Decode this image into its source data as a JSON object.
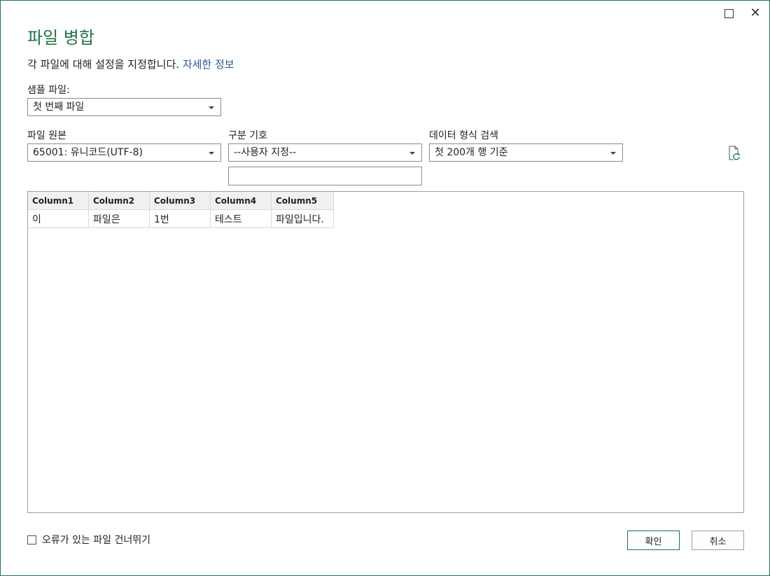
{
  "dialog": {
    "title": "파일 병합",
    "subtitle": "각 파일에 대해 설정을 지정합니다.",
    "learn_more": "자세한 정보"
  },
  "sample_file": {
    "label": "샘플 파일:",
    "value": "첫 번째 파일"
  },
  "file_origin": {
    "label": "파일 원본",
    "value": "65001: 유니코드(UTF-8)"
  },
  "delimiter": {
    "label": "구분 기호",
    "value": "--사용자 지정--",
    "custom_value": ""
  },
  "data_type_detection": {
    "label": "데이터 형식 검색",
    "value": "첫 200개 행 기준"
  },
  "preview": {
    "columns": [
      "Column1",
      "Column2",
      "Column3",
      "Column4",
      "Column5"
    ],
    "rows": [
      [
        "이",
        "파일은",
        "1번",
        "테스트",
        "파일입니다."
      ]
    ]
  },
  "skip_errors": {
    "label": "오류가 있는 파일 건너뛰기",
    "checked": false
  },
  "buttons": {
    "ok": "확인",
    "cancel": "취소"
  },
  "colors": {
    "accent": "#217346",
    "link": "#2b5797"
  },
  "icons": {
    "refresh": "refresh-file-icon",
    "maximize": "maximize-icon",
    "close": "close-icon"
  }
}
